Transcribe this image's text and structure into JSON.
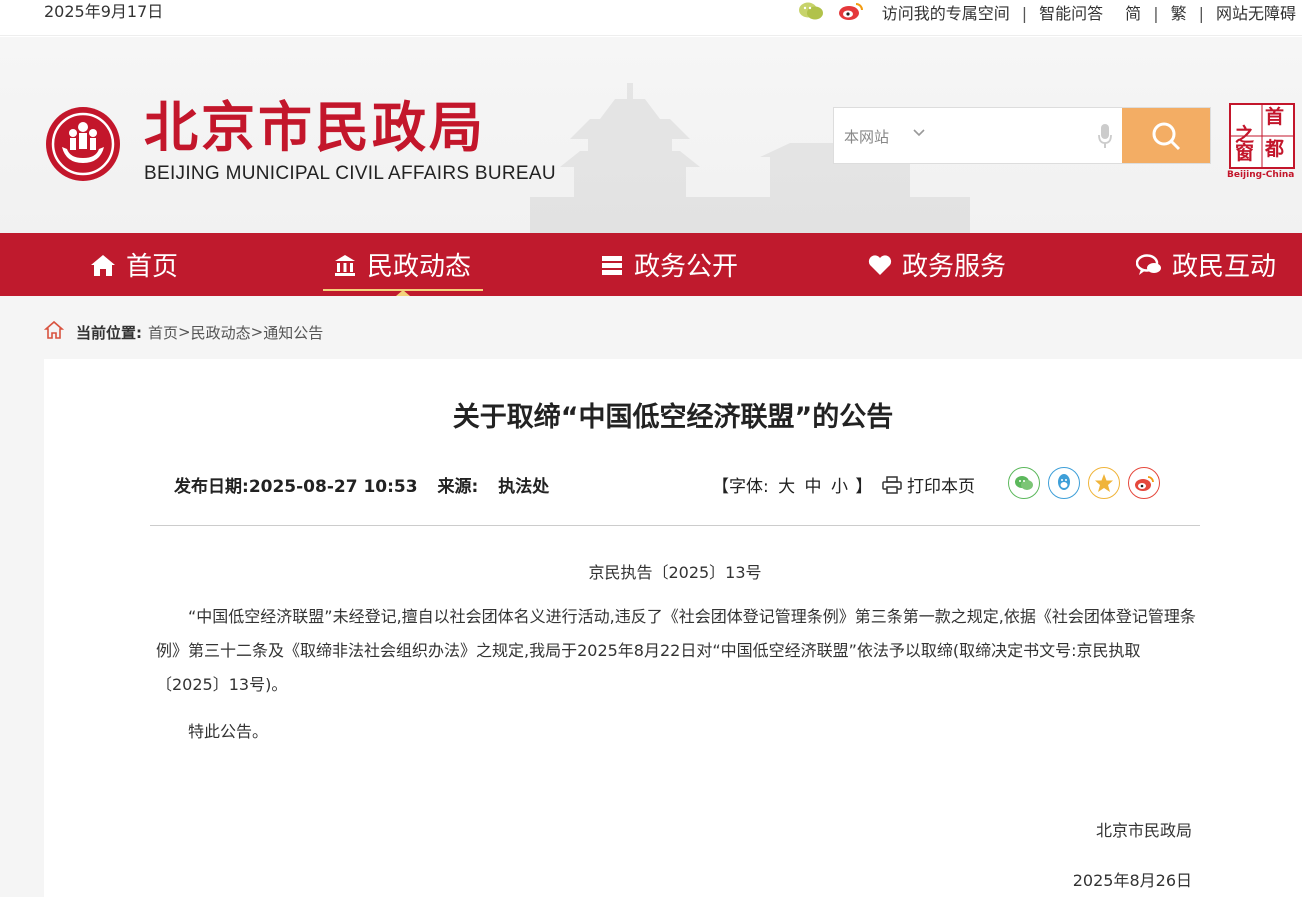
{
  "topbar": {
    "date": "2025年9月17日",
    "links": [
      "访问我的专属空间",
      "智能问答",
      "简",
      "繁",
      "网站无障碍"
    ]
  },
  "header": {
    "title_cn": "北京市民政局",
    "title_en": "BEIJING MUNICIPAL CIVIL AFFAIRS BUREAU",
    "search_scope": "本网站",
    "capital_badge": {
      "chars": [
        "之",
        "首",
        "窗",
        "都"
      ],
      "caption": "Beijing-China"
    }
  },
  "nav": {
    "items": [
      {
        "label": "首页",
        "icon": "home-icon"
      },
      {
        "label": "民政动态",
        "icon": "building-icon",
        "active": true
      },
      {
        "label": "政务公开",
        "icon": "book-icon"
      },
      {
        "label": "政务服务",
        "icon": "heart-icon"
      },
      {
        "label": "政民互动",
        "icon": "chat-icon"
      }
    ]
  },
  "breadcrumb": {
    "label": "当前位置:",
    "items": [
      "首页",
      "民政动态",
      "通知公告"
    ],
    "sep": ">"
  },
  "article": {
    "title": "关于取缔“中国低空经济联盟”的公告",
    "publish_label": "发布日期:",
    "publish_date": "2025-08-27 10:53",
    "source_label": "来源:",
    "source": "执法处",
    "font_label_open": "【字体:",
    "font_big": "大",
    "font_mid": "中",
    "font_small": "小",
    "font_label_close": "】",
    "print_label": "打印本页",
    "share_icons": [
      "wechat-icon",
      "qq-icon",
      "qzone-icon",
      "weibo-icon"
    ],
    "doc_number": "京民执告〔2025〕13号",
    "body": "“中国低空经济联盟”未经登记,擅自以社会团体名义进行活动,违反了《社会团体登记管理条例》第三条第一款之规定,依据《社会团体登记管理条例》第三十二条及《取缔非法社会组织办法》之规定,我局于2025年8月22日对“中国低空经济联盟”依法予以取缔(取缔决定书文号:京民执取〔2025〕13号)。",
    "closing": "特此公告。",
    "signature": "北京市民政局",
    "signature_date": "2025年8月26日"
  },
  "colors": {
    "brand_red": "#bf1a2d",
    "search_btn": "#f3ad64",
    "active_underline": "#f3d27b"
  }
}
